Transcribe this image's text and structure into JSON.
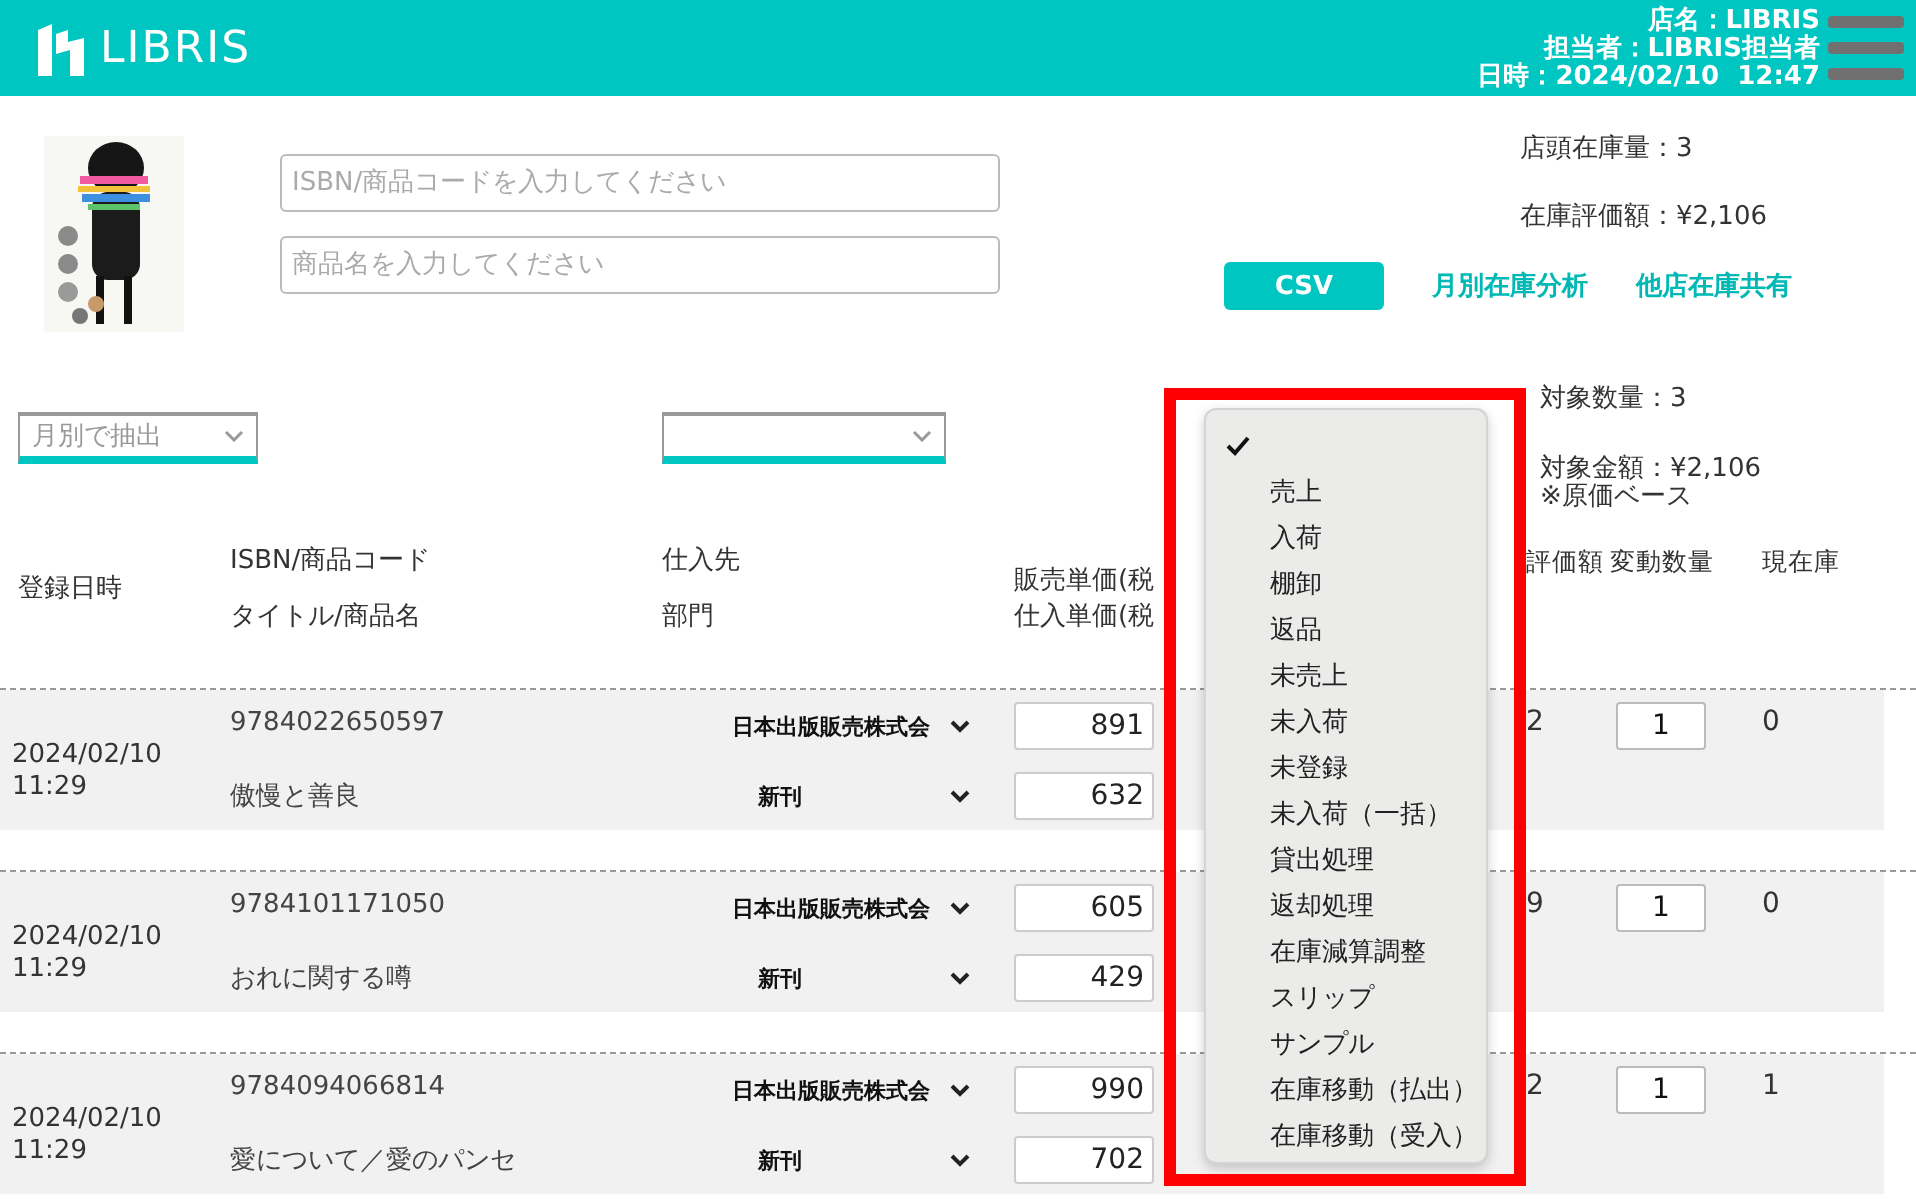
{
  "header": {
    "logo": "LIBRIS",
    "info": [
      "店名：LIBRIS",
      "担当者：LIBRIS担当者",
      "日時：2024/02/10  12:47"
    ]
  },
  "search": {
    "fields": [
      {
        "placeholder": "ISBN/商品コードを入力してください"
      },
      {
        "placeholder": "商品名を入力してください"
      }
    ]
  },
  "summary": [
    "店頭在庫量：3",
    "在庫評価額：¥2,106"
  ],
  "actions": {
    "csv": "CSV",
    "links": [
      "月別在庫分析",
      "他店在庫共有"
    ]
  },
  "filters": {
    "month": "月別で抽出"
  },
  "target": {
    "quantity": "対象数量：3",
    "amount": "対象金額：¥2,106",
    "note": "※原価ベース"
  },
  "table": {
    "columns": {
      "date": "登録日時",
      "isbn": "ISBN/商品コード",
      "title": "タイトル/商品名",
      "supplier": "仕入先",
      "department": "部門",
      "sale_price": "販売単価(税",
      "cost_price": "仕入単価(税",
      "valuation": "評価額",
      "change": "変動数量",
      "stock": "現在庫"
    },
    "rows": [
      {
        "date": "2024/02/10\n11:29",
        "isbn": "9784022650597",
        "title": "傲慢と善良",
        "supplier": "日本出版販売株式会",
        "department": "新刊",
        "sale_price": "891",
        "cost_price": "632",
        "valuation": "2",
        "change": "1",
        "stock": "0"
      },
      {
        "date": "2024/02/10\n11:29",
        "isbn": "9784101171050",
        "title": "おれに関する噂",
        "supplier": "日本出版販売株式会",
        "department": "新刊",
        "sale_price": "605",
        "cost_price": "429",
        "valuation": "9",
        "change": "1",
        "stock": "0"
      },
      {
        "date": "2024/02/10\n11:29",
        "isbn": "9784094066814",
        "title": "愛について／愛のパンセ",
        "supplier": "日本出版販売株式会",
        "department": "新刊",
        "sale_price": "990",
        "cost_price": "702",
        "valuation": "2",
        "change": "1",
        "stock": "1"
      }
    ]
  },
  "menu": {
    "items": [
      {
        "selected": true
      },
      {
        "label": "売上",
        "selected": false
      },
      {
        "label": "入荷",
        "selected": false
      },
      {
        "label": "棚卸",
        "selected": false
      },
      {
        "label": "返品",
        "selected": false
      },
      {
        "label": "未売上",
        "selected": false
      },
      {
        "label": "未入荷",
        "selected": false
      },
      {
        "label": "未登録",
        "selected": false
      },
      {
        "label": "未入荷（一括）",
        "selected": false
      },
      {
        "label": "貸出処理",
        "selected": false
      },
      {
        "label": "返却処理",
        "selected": false
      },
      {
        "label": "在庫減算調整",
        "selected": false
      },
      {
        "label": "スリップ",
        "selected": false
      },
      {
        "label": "サンプル",
        "selected": false
      },
      {
        "label": "在庫移動（払出）",
        "selected": false
      },
      {
        "label": "在庫移動（受入）",
        "selected": false
      }
    ]
  }
}
